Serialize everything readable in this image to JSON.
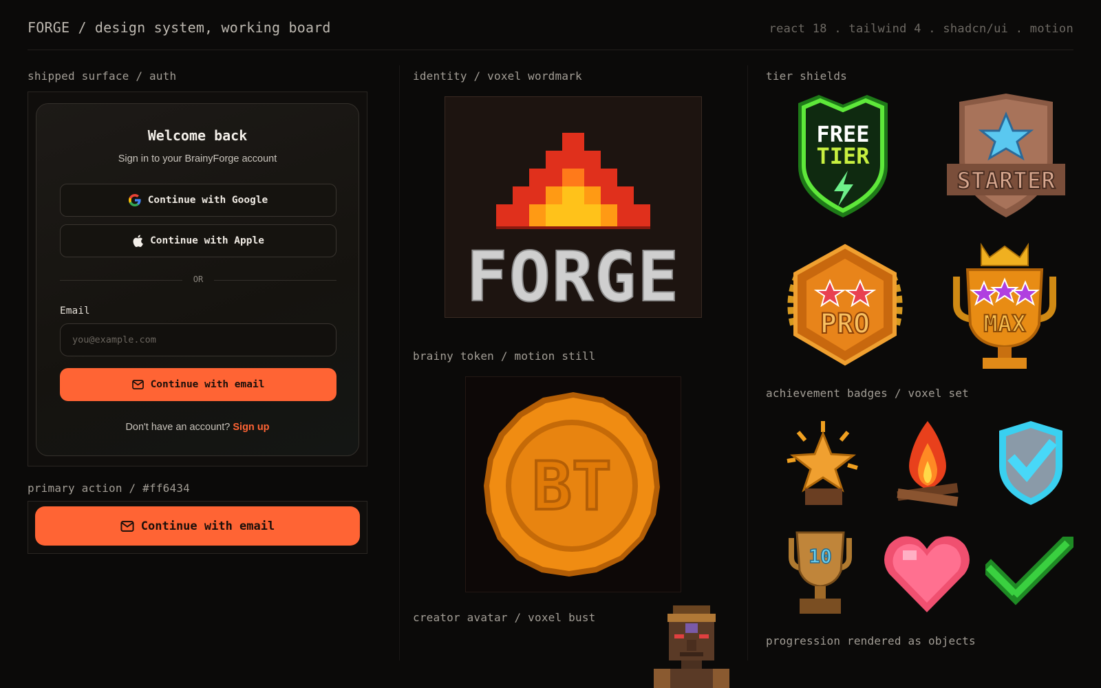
{
  "header": {
    "title": "FORGE / design system, working board",
    "stack": "react 18 . tailwind 4 . shadcn/ui . motion"
  },
  "sections": {
    "auth": "shipped surface / auth",
    "primary_action": "primary action / #ff6434",
    "identity": "identity / voxel wordmark",
    "token": "brainy token / motion still",
    "avatar": "creator avatar / voxel bust",
    "tiers": "tier shields",
    "badges": "achievement badges / voxel set",
    "progression": "progression rendered as objects"
  },
  "auth": {
    "title": "Welcome back",
    "subtitle": "Sign in to your BrainyForge account",
    "google_label": "Continue with Google",
    "apple_label": "Continue with Apple",
    "or_label": "OR",
    "email_label": "Email",
    "email_placeholder": "you@example.com",
    "email_value": "",
    "cta_label": "Continue with email",
    "signup_prompt": "Don't have an account?",
    "signup_link": "Sign up"
  },
  "primary_action": {
    "cta_label": "Continue with email",
    "color": "#ff6434"
  },
  "wordmark": {
    "text": "FORGE"
  },
  "token": {
    "text": "BT"
  },
  "tiers": [
    {
      "name": "free",
      "line1": "FREE",
      "line2": "TIER"
    },
    {
      "name": "starter",
      "line1": "STARTER"
    },
    {
      "name": "pro",
      "line1": "PRO"
    },
    {
      "name": "max",
      "line1": "MAX"
    }
  ],
  "badges": [
    {
      "name": "star"
    },
    {
      "name": "campfire"
    },
    {
      "name": "shield-check"
    },
    {
      "name": "trophy",
      "label": "10"
    },
    {
      "name": "heart"
    },
    {
      "name": "checkmark"
    }
  ],
  "colors": {
    "accent": "#ff6434",
    "background": "#0b0a09"
  }
}
